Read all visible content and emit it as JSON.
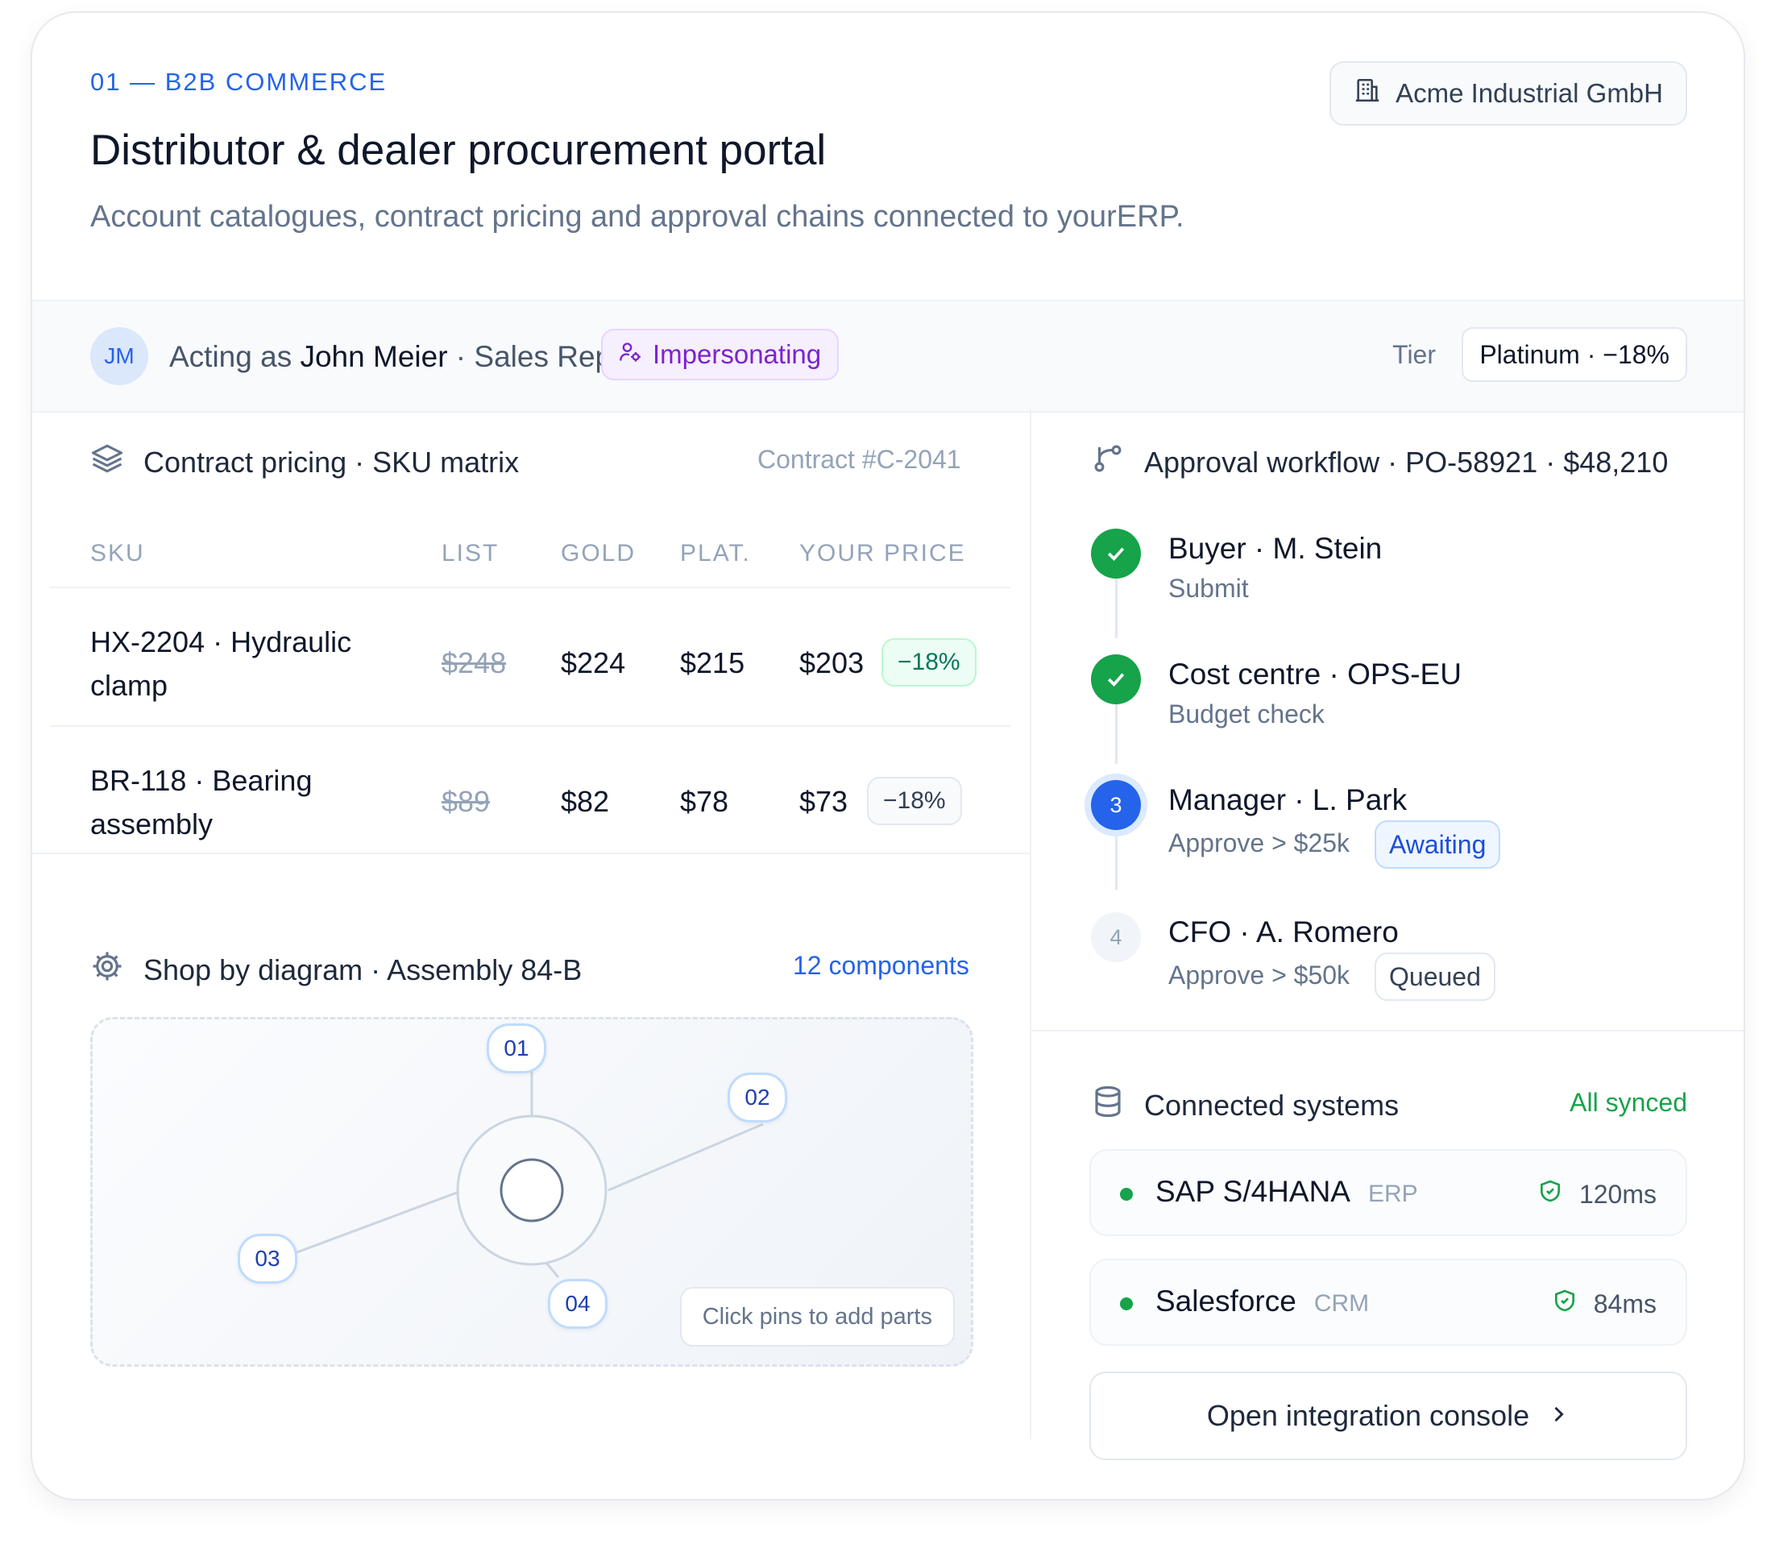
{
  "header": {
    "eyebrow": "01 — B2B COMMERCE",
    "title": "Distributor & dealer procurement portal",
    "subtitle": "Account catalogues, contract pricing and approval chains connected to yourERP.",
    "company": "Acme Industrial GmbH",
    "company_icon": "building-icon"
  },
  "acting": {
    "avatar_initials": "JM",
    "prefix": "Acting as",
    "user": "John Meier",
    "role": "· Sales Rep",
    "badge": "Impersonating",
    "badge_icon": "user-gear-icon",
    "tier_label": "Tier",
    "tier_value": "Platinum · −18%"
  },
  "pricing": {
    "title": "Contract pricing · SKU matrix",
    "icon": "layers-icon",
    "contract": "Contract #C-2041",
    "columns": [
      "SKU",
      "LIST",
      "GOLD",
      "PLAT.",
      "YOUR PRICE"
    ],
    "rows": [
      {
        "sku": "HX-2204 · Hydraulic clamp",
        "list": "$248",
        "gold": "$224",
        "plat": "$215",
        "price": "$203",
        "discount": "−18%"
      },
      {
        "sku": "BR-118 · Bearing assembly",
        "list": "$89",
        "gold": "$82",
        "plat": "$78",
        "price": "$73",
        "discount": "−18%"
      }
    ]
  },
  "diagram": {
    "title": "Shop by diagram · Assembly 84-B",
    "icon": "gear-icon",
    "components_link": "12 components",
    "pins": [
      "01",
      "02",
      "03",
      "04"
    ],
    "hint": "Click pins to add parts"
  },
  "approval": {
    "title": "Approval workflow · PO-58921 · $48,210",
    "icon": "branch-icon",
    "steps": [
      {
        "title": "Buyer · M. Stein",
        "sub": "Submit",
        "state": "done",
        "marker": ""
      },
      {
        "title": "Cost centre · OPS-EU",
        "sub": "Budget check",
        "state": "done",
        "marker": ""
      },
      {
        "title": "Manager · L. Park",
        "sub": "Approve > $25k",
        "state": "current",
        "marker": "3",
        "tag": "Awaiting"
      },
      {
        "title": "CFO · A. Romero",
        "sub": "Approve > $50k",
        "state": "pending",
        "marker": "4",
        "tag": "Queued"
      }
    ]
  },
  "systems": {
    "title": "Connected systems",
    "icon": "database-icon",
    "status": "All synced",
    "items": [
      {
        "name": "SAP S/4HANA",
        "type": "ERP",
        "latency": "120ms"
      },
      {
        "name": "Salesforce",
        "type": "CRM",
        "latency": "84ms"
      }
    ],
    "console_button": "Open integration console"
  },
  "colors": {
    "accent": "#2563eb",
    "success": "#16a34a",
    "purple": "#7e22ce",
    "muted": "#64748b"
  }
}
